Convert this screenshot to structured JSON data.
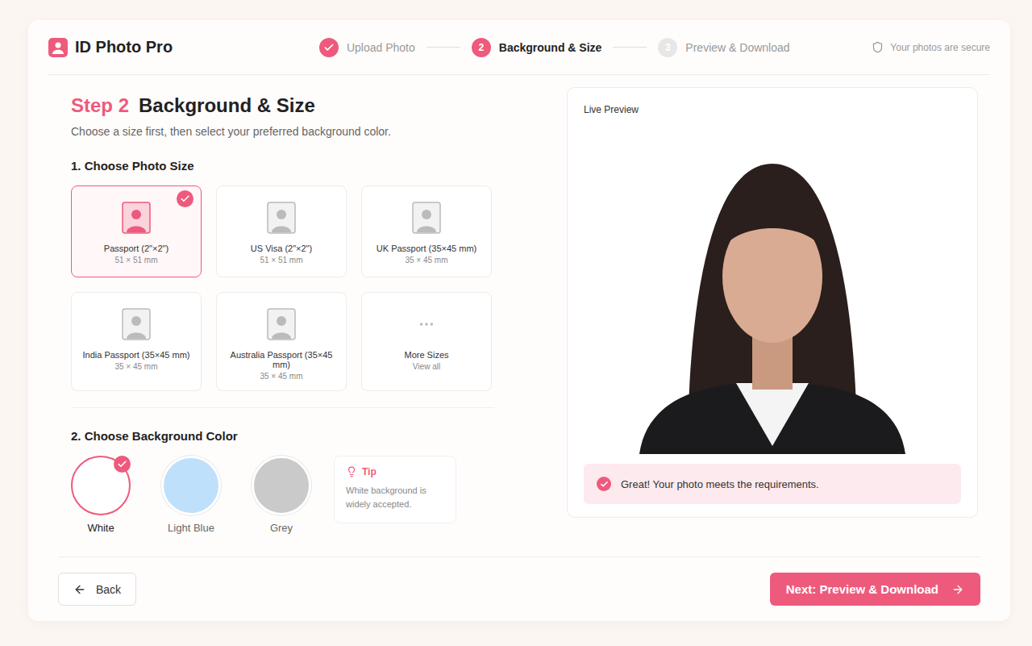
{
  "app": {
    "title": "ID Photo Pro"
  },
  "steps": [
    {
      "label": "Upload Photo",
      "completed": true,
      "selected": false
    },
    {
      "number": "2",
      "label": "Background & Size",
      "completed": false,
      "selected": true
    },
    {
      "number": "3",
      "label": "Preview & Download",
      "completed": false,
      "selected": false
    }
  ],
  "security": "Your photos are secure",
  "heading": {
    "step": "Step 2",
    "title": "Background & Size",
    "subtitle": "Choose a size first, then select your preferred background color."
  },
  "size_section": {
    "title": "1. Choose Photo Size",
    "options": [
      {
        "kind": "size",
        "label": "Passport (2\"×2\")",
        "dimensions": "51 × 51 mm",
        "selected": true
      },
      {
        "kind": "size",
        "label": "US Visa (2\"×2\")",
        "dimensions": "51 × 51 mm",
        "selected": false
      },
      {
        "kind": "size",
        "label": "UK Passport (35×45 mm)",
        "dimensions": "35 × 45 mm",
        "selected": false
      },
      {
        "kind": "size",
        "label": "India Passport (35×45 mm)",
        "dimensions": "35 × 45 mm",
        "selected": false
      },
      {
        "kind": "size",
        "label": "Australia Passport (35×45 mm)",
        "dimensions": "35 × 45 mm",
        "selected": false
      },
      {
        "kind": "more",
        "label": "More Sizes",
        "dimensions": "View all",
        "selected": false
      }
    ]
  },
  "color_section": {
    "title": "2. Choose Background Color",
    "options": [
      {
        "label": "White",
        "color": "#ffffff",
        "selected": true
      },
      {
        "label": "Light Blue",
        "color": "#bfe0fb",
        "selected": false
      },
      {
        "label": "Grey",
        "color": "#cacaca",
        "selected": false
      }
    ],
    "tip": {
      "title": "Tip",
      "text": "White background is widely accepted."
    }
  },
  "preview": {
    "title": "Live Preview",
    "status": "Great! Your photo meets the requirements."
  },
  "footer": {
    "back": "Back",
    "next": "Next: Preview & Download"
  }
}
